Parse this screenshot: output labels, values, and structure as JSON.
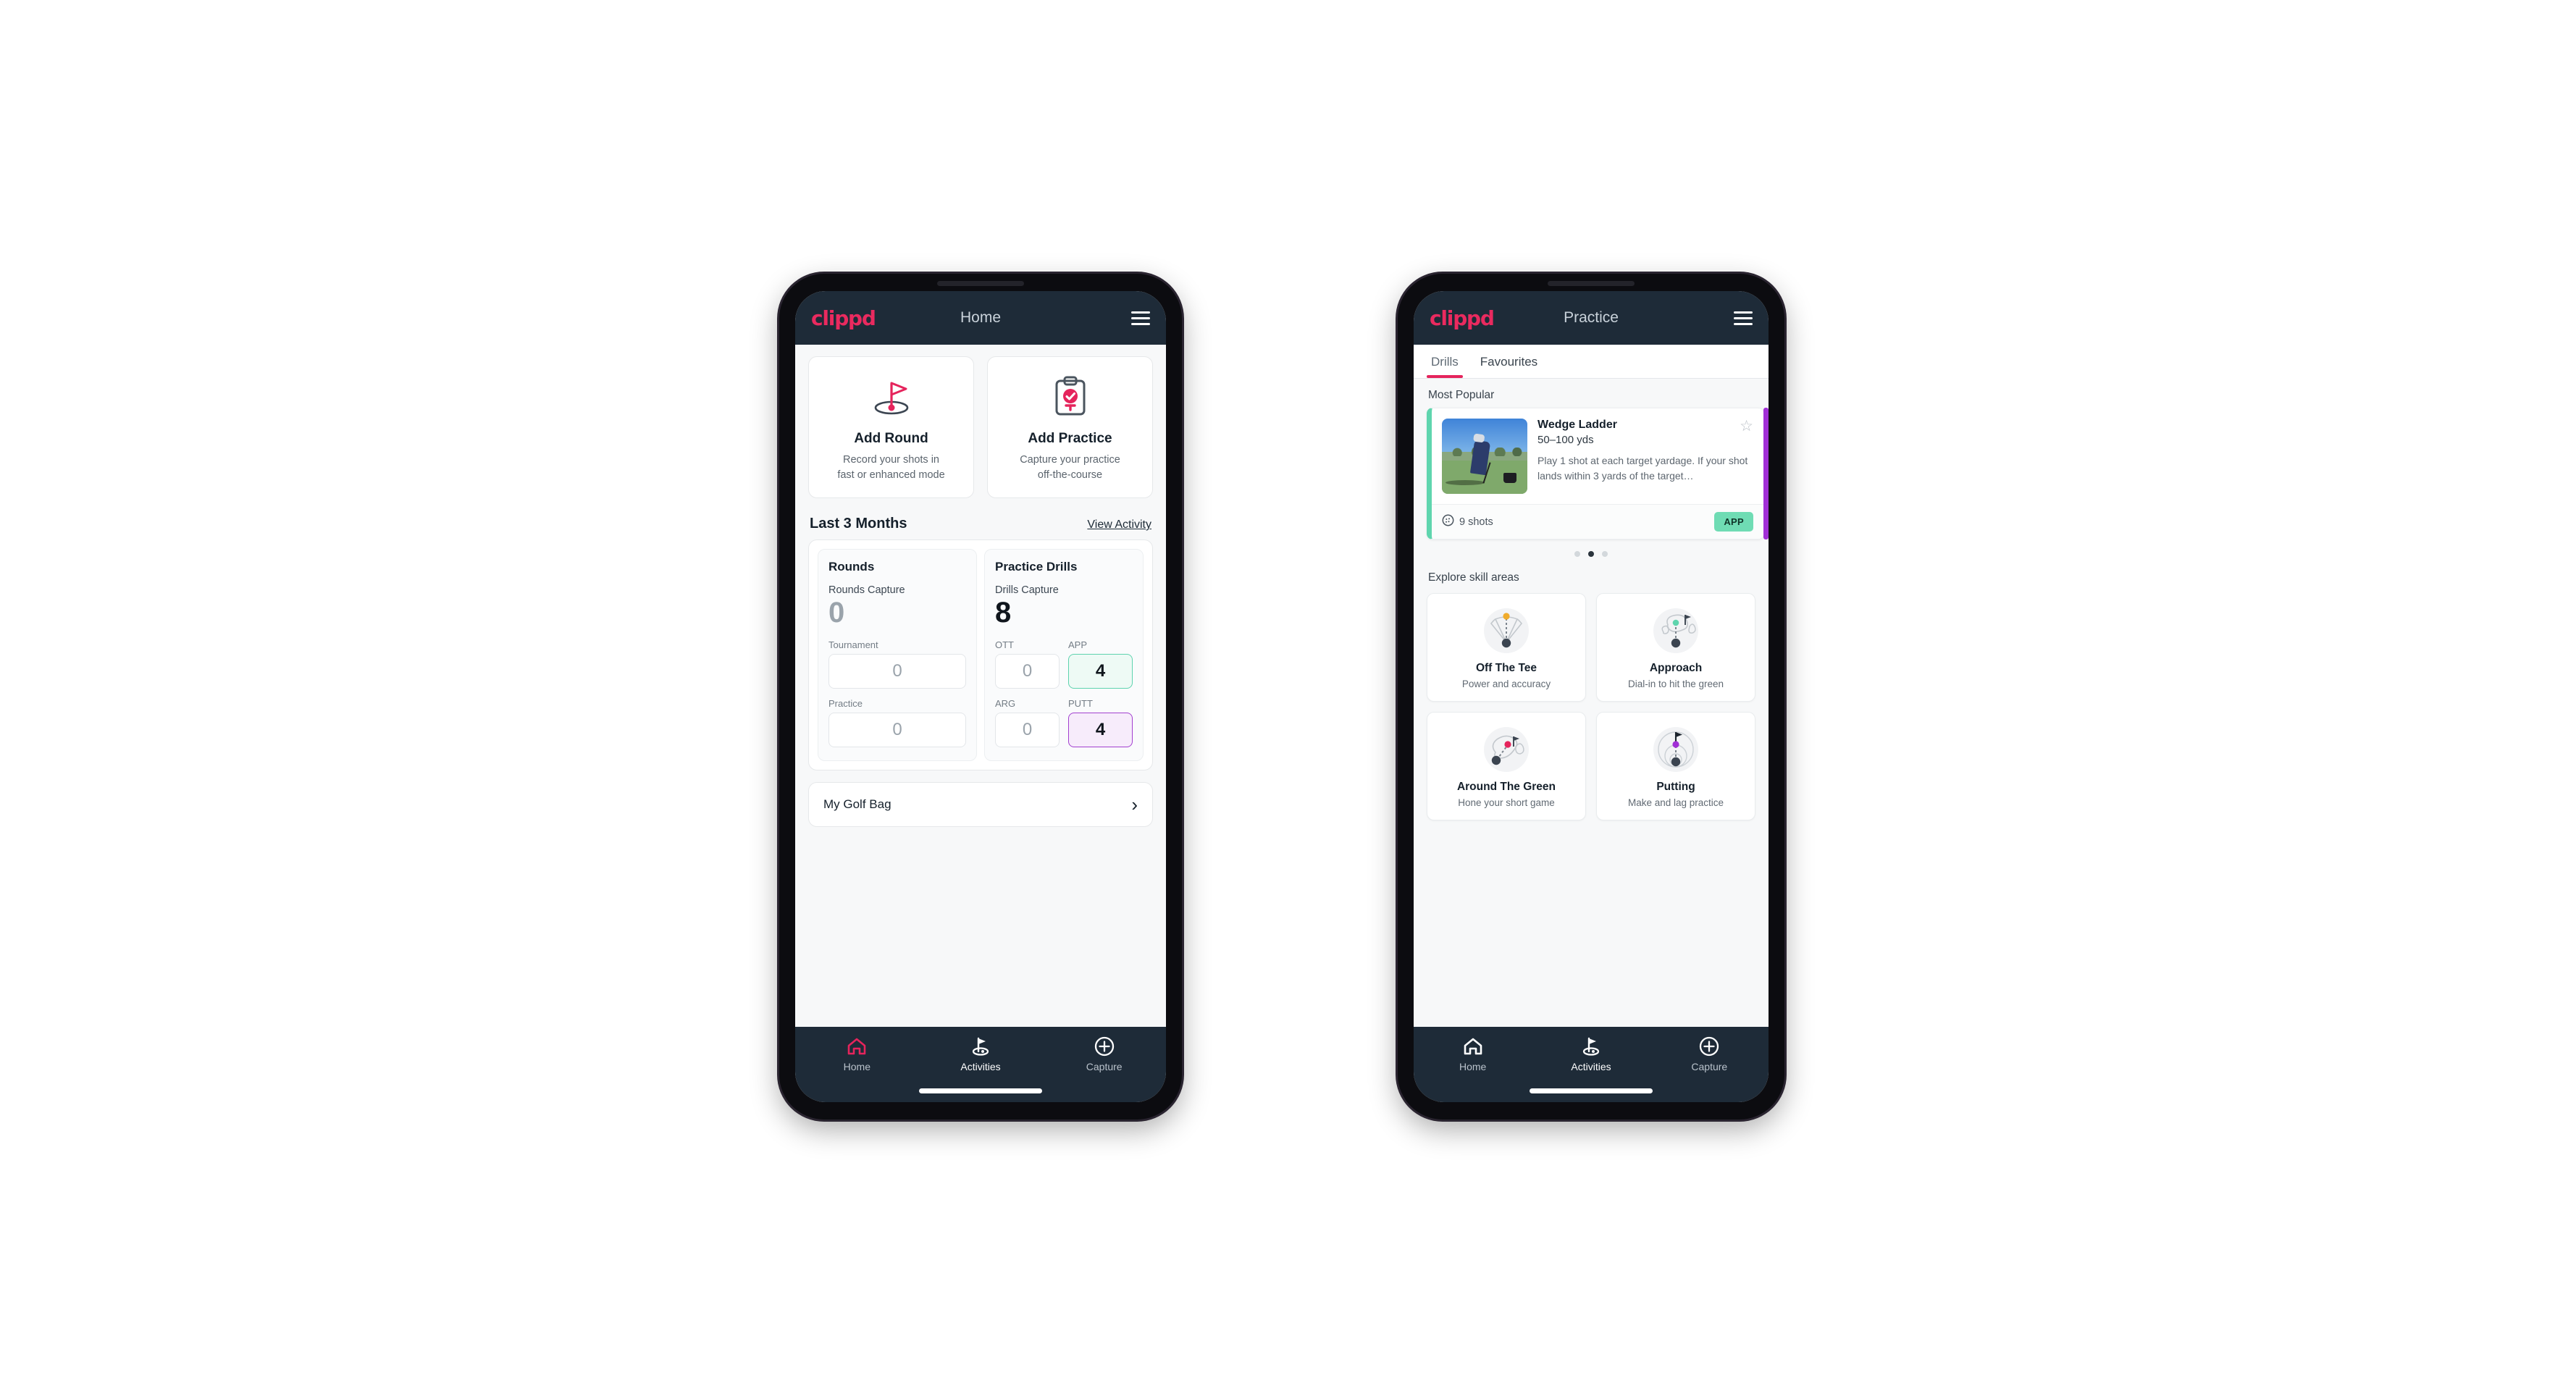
{
  "brand": {
    "logo_text": "clippd",
    "accent": "#ea2a5f"
  },
  "home_phone": {
    "appbar": {
      "title": "Home",
      "menu_icon": "hamburger-icon"
    },
    "actions": [
      {
        "icon": "golf-flag-hole-icon",
        "title": "Add Round",
        "sub_line1": "Record your shots in",
        "sub_line2": "fast or enhanced mode"
      },
      {
        "icon": "clipboard-check-icon",
        "title": "Add Practice",
        "sub_line1": "Capture your practice",
        "sub_line2": "off-the-course"
      }
    ],
    "section": {
      "title": "Last 3 Months",
      "link": "View Activity"
    },
    "rounds": {
      "heading": "Rounds",
      "capture_label": "Rounds Capture",
      "capture_value": "0",
      "fields": [
        {
          "label": "Tournament",
          "value": "0",
          "style": "plain"
        },
        {
          "label": "Practice",
          "value": "0",
          "style": "plain"
        }
      ]
    },
    "drills": {
      "heading": "Practice Drills",
      "capture_label": "Drills Capture",
      "capture_value": "8",
      "fields": [
        {
          "label": "OTT",
          "value": "0",
          "style": "plain"
        },
        {
          "label": "APP",
          "value": "4",
          "style": "app"
        },
        {
          "label": "ARG",
          "value": "0",
          "style": "plain"
        },
        {
          "label": "PUTT",
          "value": "4",
          "style": "putt"
        }
      ]
    },
    "golf_bag": {
      "label": "My Golf Bag",
      "chevron": "chevron-right-icon"
    },
    "bottom_nav": [
      {
        "icon": "home-icon",
        "label": "Home",
        "state": "selected-pink"
      },
      {
        "icon": "golf-flag-icon",
        "label": "Activities",
        "state": "active"
      },
      {
        "icon": "plus-circle-icon",
        "label": "Capture",
        "state": "normal"
      }
    ]
  },
  "practice_phone": {
    "appbar": {
      "title": "Practice",
      "menu_icon": "hamburger-icon"
    },
    "tabs": [
      {
        "label": "Drills",
        "active": true
      },
      {
        "label": "Favourites",
        "active": false
      }
    ],
    "most_popular_label": "Most Popular",
    "drill": {
      "name": "Wedge Ladder",
      "yardage": "50–100 yds",
      "description": "Play 1 shot at each target yardage. If your shot lands within 3 yards of the target…",
      "shots": "9 shots",
      "shots_icon": "golf-ball-icon",
      "chip": "APP",
      "star_icon": "star-outline-icon",
      "accent": "#5fd5ae",
      "next_card_accent": "#a12fd6"
    },
    "carousel_dots": {
      "count": 3,
      "active_index": 1
    },
    "skill_label": "Explore skill areas",
    "skills": [
      {
        "icon": "tee-shot-dispersion-icon",
        "title": "Off The Tee",
        "sub": "Power and accuracy"
      },
      {
        "icon": "approach-green-icon",
        "title": "Approach",
        "sub": "Dial-in to hit the green"
      },
      {
        "icon": "around-green-icon",
        "title": "Around The Green",
        "sub": "Hone your short game"
      },
      {
        "icon": "putting-rings-icon",
        "title": "Putting",
        "sub": "Make and lag practice"
      }
    ],
    "bottom_nav": [
      {
        "icon": "home-icon",
        "label": "Home",
        "state": "normal"
      },
      {
        "icon": "golf-flag-icon",
        "label": "Activities",
        "state": "active"
      },
      {
        "icon": "plus-circle-icon",
        "label": "Capture",
        "state": "normal"
      }
    ]
  }
}
